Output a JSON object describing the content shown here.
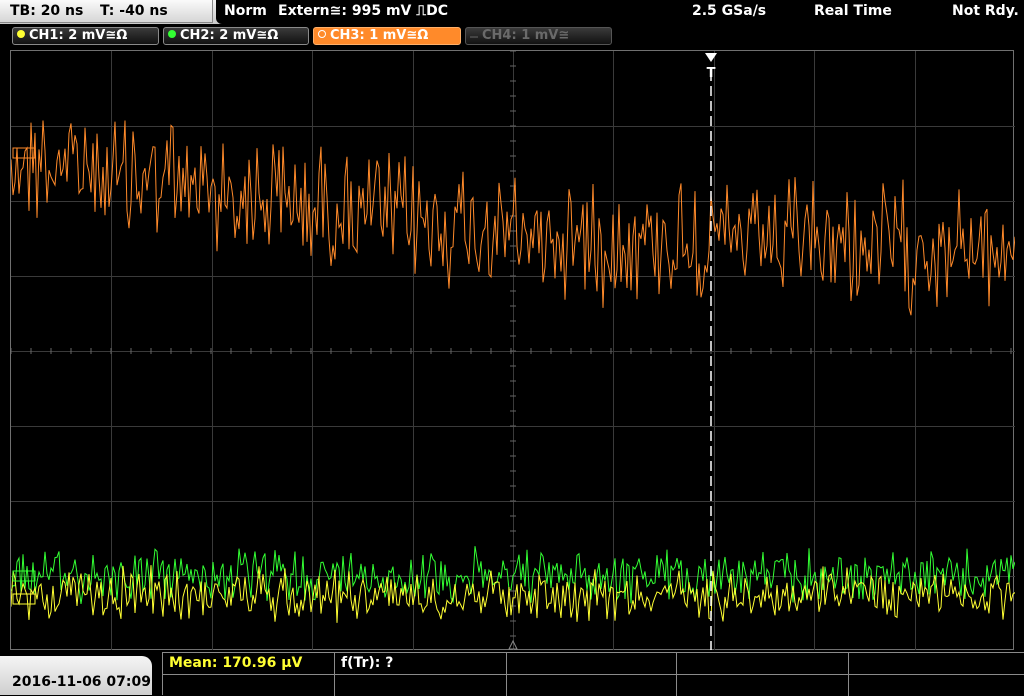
{
  "timebase": {
    "tb": "TB: 20 ns",
    "trigger_pos": "T: -40 ns"
  },
  "status": {
    "mode": "Norm",
    "trigger_source": "Extern",
    "coupling_symbol": "≅",
    "trigger_level": ": 995 mV",
    "slope_symbol": "⎍",
    "trigger_coupling": "DC",
    "sample_rate": "2.5 GSa/s",
    "acq_mode": "Real Time",
    "state": "Not Rdy."
  },
  "channels": [
    {
      "label": "CH1: 2 mV≅Ω",
      "color": "#ffff33",
      "state": "on"
    },
    {
      "label": "CH2: 2 mV≅Ω",
      "color": "#33ff33",
      "state": "on"
    },
    {
      "label": "CH3: 1 mV≅Ω",
      "color": "#ff8a2a",
      "state": "selected"
    },
    {
      "label": "CH4: 1 mV≅",
      "color": "#555555",
      "state": "off"
    }
  ],
  "trigger_marker": {
    "label": "T"
  },
  "bottom": {
    "datetime": "2016-11-06 07:09",
    "mean": "Mean: 170.96 µV",
    "freq": "f(Tr): ?"
  },
  "colors": {
    "ch1": "#ffff33",
    "ch2": "#33ff33",
    "ch3": "#ff8a2a",
    "grid": "#3a3a3a",
    "marker": "#ffffff"
  }
}
